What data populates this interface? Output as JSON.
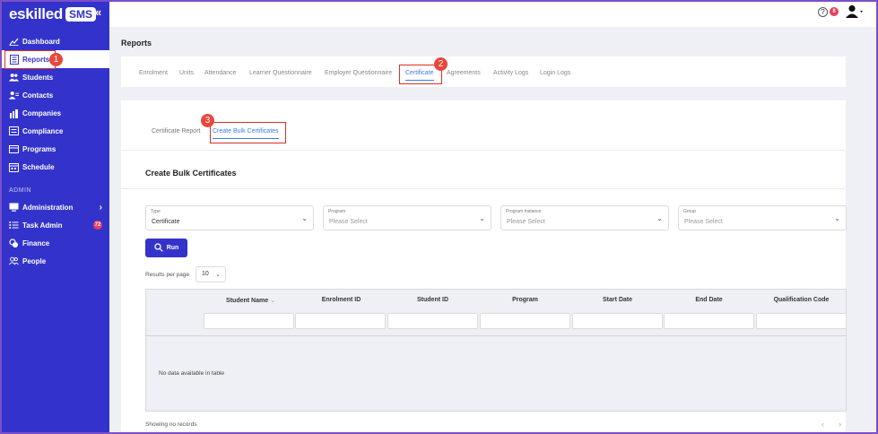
{
  "app": {
    "logo_text": "eskilled",
    "logo_badge": "SMS"
  },
  "sidebar": {
    "items": [
      {
        "label": "Dashboard"
      },
      {
        "label": "Reports"
      },
      {
        "label": "Students"
      },
      {
        "label": "Contacts"
      },
      {
        "label": "Companies"
      },
      {
        "label": "Compliance"
      },
      {
        "label": "Programs"
      },
      {
        "label": "Schedule"
      }
    ],
    "section_admin": "ADMIN",
    "admin_items": [
      {
        "label": "Administration"
      },
      {
        "label": "Task Admin",
        "badge": "72"
      },
      {
        "label": "Finance"
      },
      {
        "label": "People"
      }
    ]
  },
  "topbar": {
    "help": "?",
    "notifications": "8"
  },
  "page": {
    "title": "Reports"
  },
  "tabs": [
    "Enrolment",
    "Units",
    "Attendance",
    "Learner Questionnaire",
    "Employer Questionnaire",
    "Certificate",
    "Agreements",
    "Activity Logs",
    "Login Logs"
  ],
  "subtabs": [
    "Certificate Report",
    "Create Bulk Certificates"
  ],
  "section": {
    "title": "Create Bulk Certificates"
  },
  "filters": [
    {
      "label": "Type",
      "value": "Certificate"
    },
    {
      "label": "Program",
      "value": "Please Select"
    },
    {
      "label": "Program Instance",
      "value": "Please Select"
    },
    {
      "label": "Group",
      "value": "Please Select"
    }
  ],
  "run_button": "Run",
  "results_per_page": {
    "label": "Results per page",
    "value": "10"
  },
  "table": {
    "columns": [
      "Student Name",
      "Enrolment ID",
      "Student ID",
      "Program",
      "Start Date",
      "End Date",
      "Qualification Code"
    ],
    "empty": "No data available in table"
  },
  "footer": {
    "showing": "Showing no records",
    "prev": "‹",
    "next": "›"
  },
  "annotations": [
    "1",
    "2",
    "3"
  ],
  "colors": {
    "sidebar": "#3333cc",
    "accent": "#3b7ddd",
    "annotation": "#d93025"
  }
}
